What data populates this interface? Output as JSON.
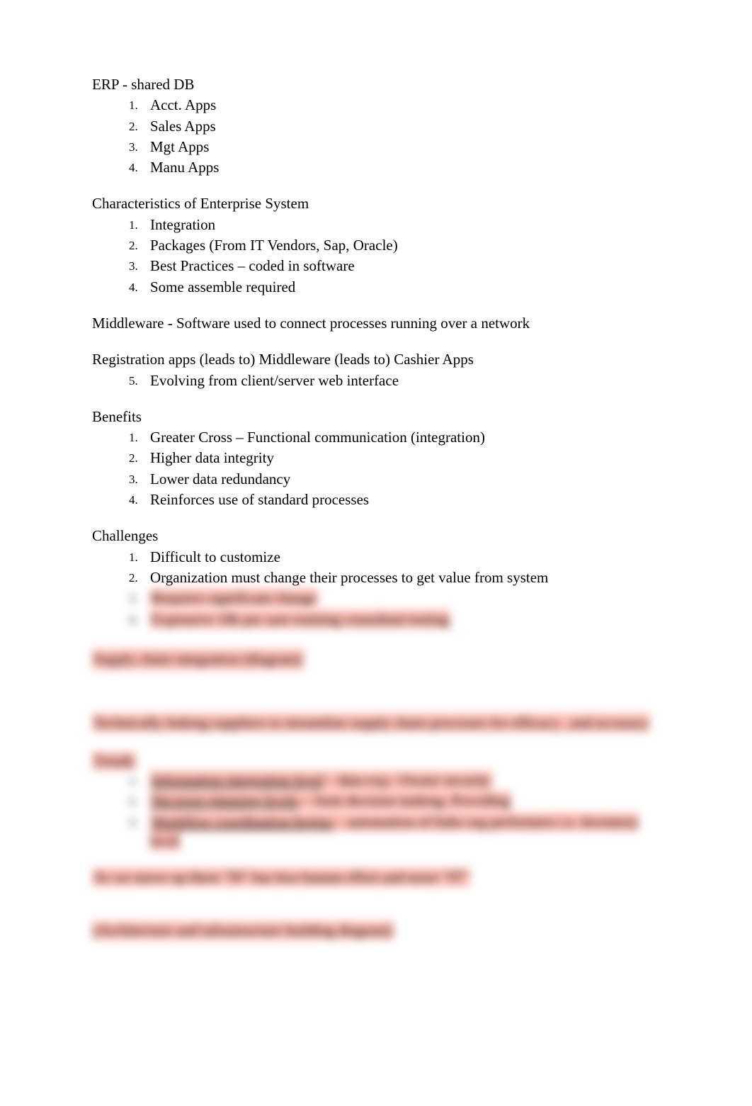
{
  "erp": {
    "title": "ERP - shared DB",
    "items": [
      {
        "num": "1.",
        "text": "Acct. Apps"
      },
      {
        "num": "2.",
        "text": "Sales Apps"
      },
      {
        "num": "3.",
        "text": "Mgt Apps"
      },
      {
        "num": "4.",
        "text": "Manu Apps"
      }
    ]
  },
  "characteristics": {
    "title": "Characteristics of Enterprise System",
    "items": [
      {
        "num": "1.",
        "text": "Integration"
      },
      {
        "num": "2.",
        "text": "Packages (From IT Vendors, Sap, Oracle)"
      },
      {
        "num": "3.",
        "text": "Best Practices – coded in software"
      },
      {
        "num": "4.",
        "text": "Some assemble required"
      }
    ]
  },
  "middleware": {
    "text": "Middleware - Software used to connect processes running over a network"
  },
  "flow": {
    "text": "Registration apps   (leads to) Middleware   (leads to) Cashier Apps",
    "sub": {
      "num": "5.",
      "text": "Evolving from client/server web interface"
    }
  },
  "benefits": {
    "title": "Benefits",
    "items": [
      {
        "num": "1.",
        "text": "Greater Cross – Functional communication (integration)"
      },
      {
        "num": "2.",
        "text": "Higher data integrity"
      },
      {
        "num": "3.",
        "text": "Lower data redundancy"
      },
      {
        "num": "4.",
        "text": "Reinforces use of standard processes"
      }
    ]
  },
  "challenges": {
    "title": "Challenges",
    "items": [
      {
        "num": "1.",
        "text": "Difficult to customize"
      },
      {
        "num": "2.",
        "text": "Organization must change their processes to get value from system"
      },
      {
        "num": "3.",
        "text": "Requires significant change"
      },
      {
        "num": "4.",
        "text": "Expensive 10k per user training consultant testing"
      }
    ]
  },
  "blurred": {
    "heading1": "Supply chain integration (diagram)",
    "para": "Technically linking suppliers to streamline supply chain processes for efficacy , and accuracy",
    "trends_title": "Trends",
    "trends": [
      {
        "num": "1.",
        "label": "Information integration level",
        "rest": " – data exp.: Owner security"
      },
      {
        "num": "2.",
        "label": "Decision planning levels",
        "rest": " – Joint decision making. Providing"
      },
      {
        "num": "3.",
        "label": "Workflow coordination begins",
        "rest": " – automation of links org performers i.e. Inventory level"
      }
    ],
    "note": "As we move up there \"IS\" has less human effort and more \"IT\"",
    "final": "(Architecture and infrastructure building diagram)"
  }
}
